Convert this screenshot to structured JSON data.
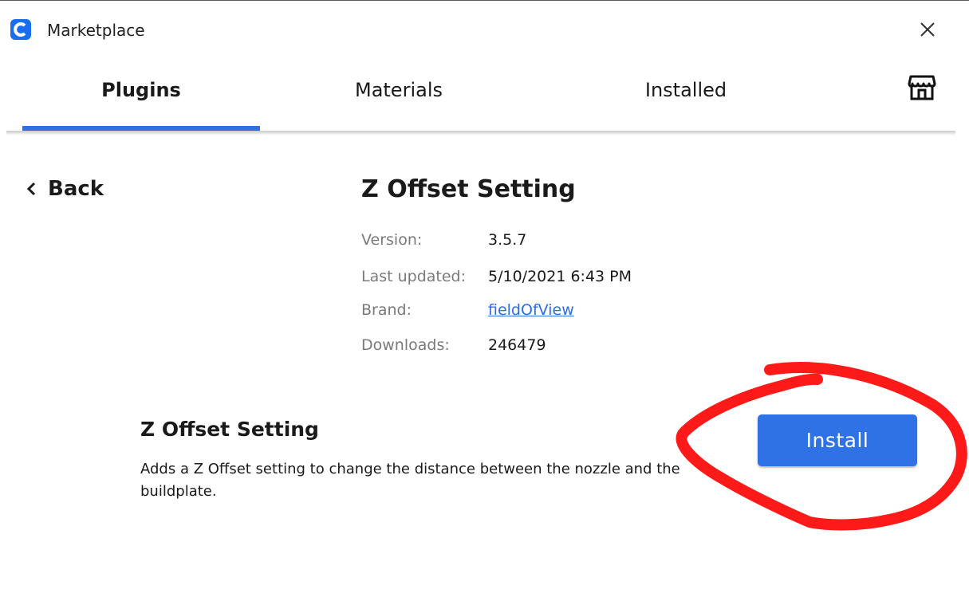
{
  "window": {
    "title": "Marketplace",
    "logo_icon": "app-logo-icon",
    "close_icon": "close-icon"
  },
  "tabs": [
    {
      "label": "Plugins",
      "active": true
    },
    {
      "label": "Materials",
      "active": false
    },
    {
      "label": "Installed",
      "active": false
    }
  ],
  "store_icon": "store-icon",
  "back": {
    "label": "Back",
    "icon": "chevron-left-icon"
  },
  "plugin": {
    "name": "Z Offset Setting",
    "meta": [
      {
        "label": "Version:",
        "value": "3.5.7"
      },
      {
        "label": "Last updated:",
        "value": "5/10/2021 6:43 PM"
      },
      {
        "label": "Brand:",
        "value": "fieldOfView",
        "is_link": true
      },
      {
        "label": "Downloads:",
        "value": "246479"
      }
    ],
    "description_title": "Z Offset Setting",
    "description_text": "Adds a Z Offset setting to change the distance between the nozzle and the buildplate.",
    "install_label": "Install"
  },
  "colors": {
    "accent": "#2e72e6",
    "link": "#2a6ee6",
    "annotation": "#ff1a1a",
    "muted_text": "#7a7a7a"
  }
}
